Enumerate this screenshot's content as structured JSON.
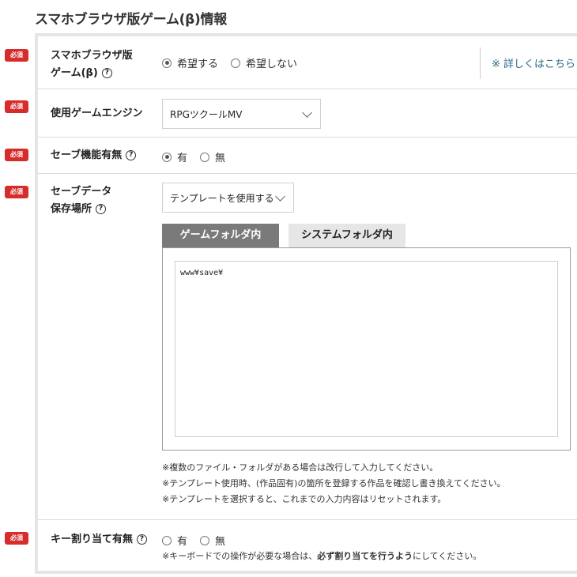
{
  "section_title": "スマホブラウザ版ゲーム(β)情報",
  "required_label": "必須",
  "help_glyph": "?",
  "rows": {
    "smartphone": {
      "label_line1": "スマホブラウザ版",
      "label_line2": "ゲーム(β)",
      "options": [
        "希望する",
        "希望しない"
      ],
      "selected": 0,
      "details_link": "※ 詳しくはこちら"
    },
    "engine": {
      "label": "使用ゲームエンジン",
      "value": "RPGツクールMV"
    },
    "save_function": {
      "label": "セーブ機能有無",
      "options": [
        "有",
        "無"
      ],
      "selected": 0
    },
    "save_location": {
      "label_line1": "セーブデータ",
      "label_line2": "保存場所",
      "template_value": "テンプレートを使用する",
      "tabs": [
        "ゲームフォルダ内",
        "システムフォルダ内"
      ],
      "active_tab": 0,
      "path_value": "www¥save¥",
      "notes": [
        "※複数のファイル・フォルダがある場合は改行して入力してください。",
        "※テンプレート使用時、(作品固有)の箇所を登録する作品を確認し書き換えてください。",
        "※テンプレートを選択すると、これまでの入力内容はリセットされます。"
      ]
    },
    "key_assign": {
      "label": "キー割り当て有無",
      "options": [
        "有",
        "無"
      ],
      "selected": -1,
      "note_prefix": "※キーボードでの操作が必要な場合は、",
      "note_bold": "必ず割り当てを行うよう",
      "note_suffix": "にしてください。"
    }
  },
  "colors": {
    "badge": "#d62c2c",
    "link": "#2a6a8a",
    "active_tab": "#7a7a7a",
    "inactive_tab": "#e6e6e6"
  }
}
